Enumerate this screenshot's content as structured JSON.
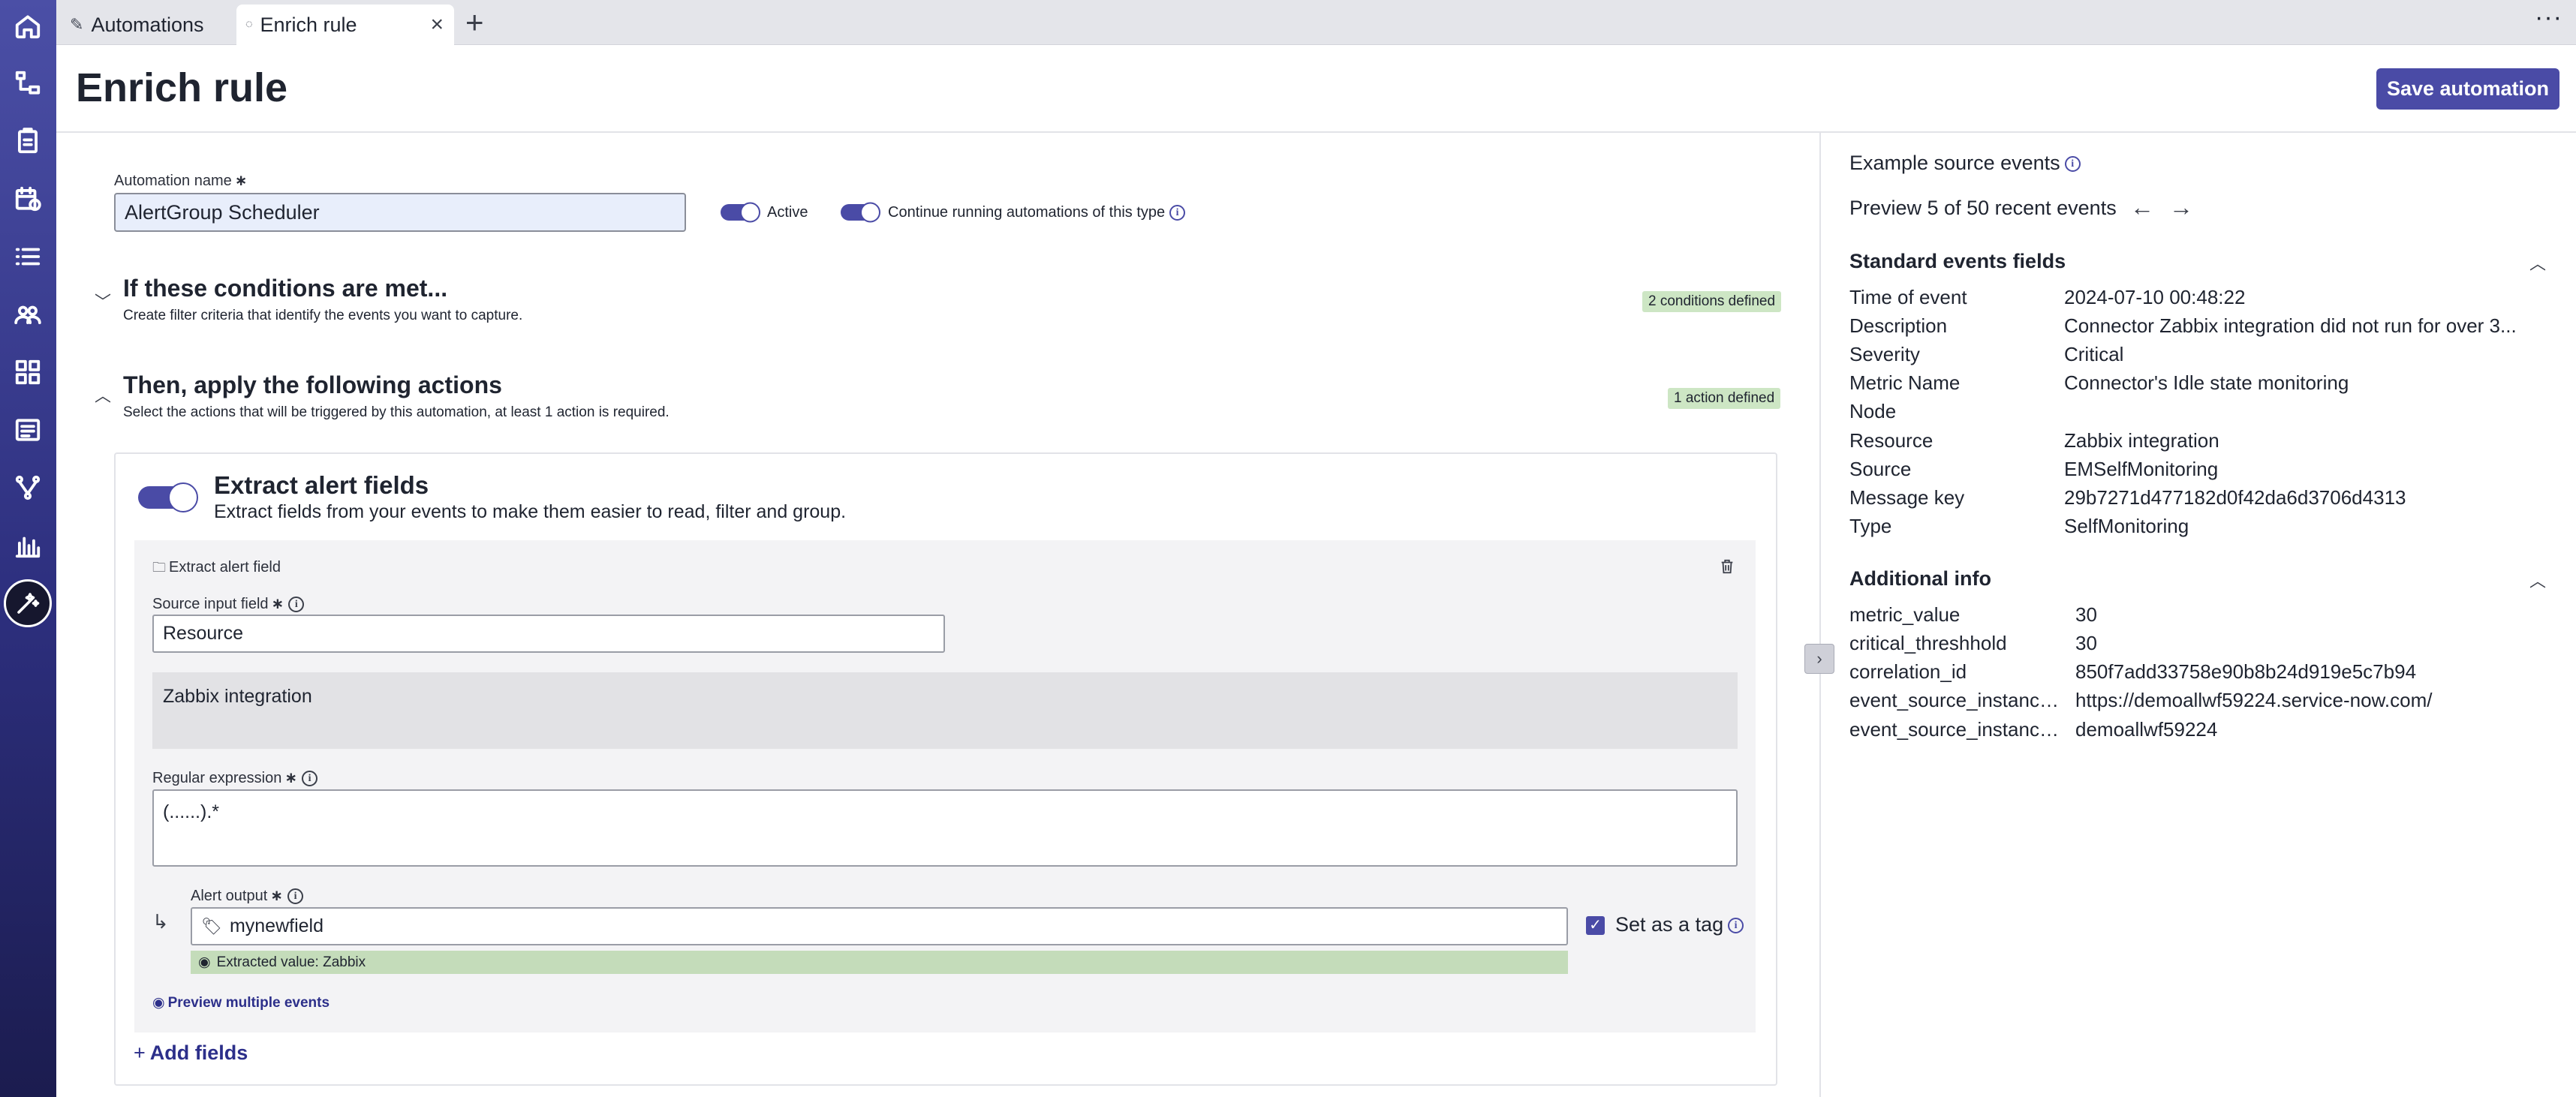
{
  "tabs": [
    {
      "label": "Automations",
      "icon": "pencil-icon"
    },
    {
      "label": "Enrich rule",
      "icon": "loading-icon"
    }
  ],
  "header": {
    "title": "Enrich rule",
    "save_label": "Save automation"
  },
  "form": {
    "name_label": "Automation name",
    "name_value": "AlertGroup Scheduler",
    "active_label": "Active",
    "continue_label": "Continue running automations of this type"
  },
  "conditions": {
    "title": "If these conditions are met...",
    "subtitle": "Create filter criteria that identify the events you want to capture.",
    "badge": "2 conditions defined"
  },
  "actions": {
    "title": "Then, apply the following actions",
    "subtitle": "Select the actions that will be triggered by this automation, at least 1 action is required.",
    "badge": "1 action defined"
  },
  "extract": {
    "title": "Extract alert fields",
    "subtitle": "Extract fields from your events to make them easier to read, filter and group.",
    "panel_label": "Extract alert field",
    "source_label": "Source input field",
    "source_value": "Resource",
    "source_preview": "Zabbix integration",
    "regex_label": "Regular expression",
    "regex_value": "(......).*",
    "output_label": "Alert output",
    "output_value": "mynewfield",
    "extracted_value": "Extracted value: Zabbix",
    "tag_label": "Set as a tag",
    "preview_multiple": "Preview multiple events",
    "add_fields": "Add fields"
  },
  "right": {
    "example_label": "Example source events",
    "preview_text": "Preview 5 of 50 recent events",
    "standard_title": "Standard events fields",
    "standard": [
      {
        "key": "Time of event",
        "value": "2024-07-10 00:48:22"
      },
      {
        "key": "Description",
        "value": "Connector Zabbix integration did not run for over 3..."
      },
      {
        "key": "Severity",
        "value": "Critical"
      },
      {
        "key": "Metric Name",
        "value": "Connector's Idle state monitoring"
      },
      {
        "key": "Node",
        "value": ""
      },
      {
        "key": "Resource",
        "value": "Zabbix integration"
      },
      {
        "key": "Source",
        "value": "EMSelfMonitoring"
      },
      {
        "key": "Message key",
        "value": "29b7271d477182d0f42da6d3706d4313"
      },
      {
        "key": "Type",
        "value": "SelfMonitoring"
      }
    ],
    "additional_title": "Additional info",
    "additional": [
      {
        "key": "metric_value",
        "value": "30"
      },
      {
        "key": "critical_threshhold",
        "value": "30"
      },
      {
        "key": "correlation_id",
        "value": "850f7add33758e90b8b24d919e5c7b94"
      },
      {
        "key": "event_source_instance...",
        "value": "https://demoallwf59224.service-now.com/"
      },
      {
        "key": "event_source_instance...",
        "value": "demoallwf59224"
      }
    ]
  },
  "colors": {
    "accent": "#4a4ba6",
    "badge_green": "#cde6c4",
    "extracted_green": "#c4dcba"
  }
}
